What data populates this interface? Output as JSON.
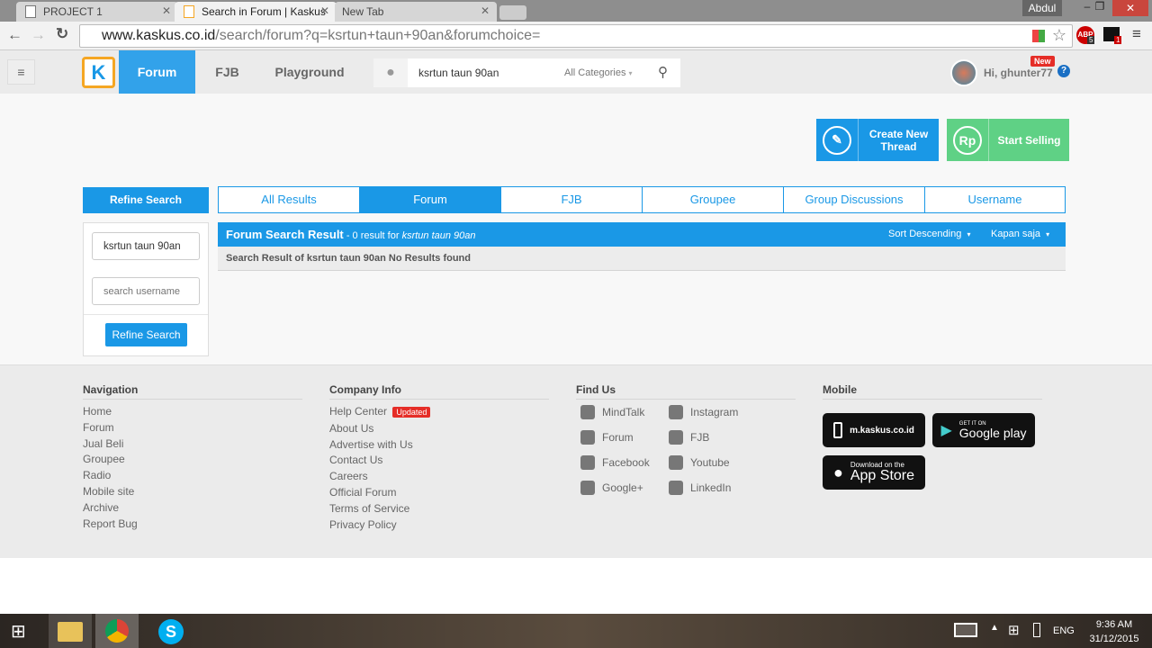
{
  "browser": {
    "tabs": [
      {
        "label": "PROJECT 1"
      },
      {
        "label": "Search in Forum | Kaskus -"
      },
      {
        "label": "New Tab"
      }
    ],
    "user": "Abdul",
    "url_host": "www.kaskus.co.id",
    "url_path": "/search/forum?q=ksrtun+taun+90an&forumchoice=",
    "abp_count": "5",
    "ext_count": "1"
  },
  "header": {
    "nav": [
      "Forum",
      "FJB",
      "Playground"
    ],
    "search_value": "ksrtun taun 90an",
    "category": "All Categories",
    "new_badge": "New",
    "greeting": "Hi, ghunter77"
  },
  "actions": {
    "create": "Create New Thread",
    "sell": "Start Selling"
  },
  "refine": {
    "title": "Refine Search",
    "query_value": "ksrtun taun 90an",
    "username_placeholder": "search username",
    "button": "Refine Search"
  },
  "search_tabs": [
    {
      "label": "All Results"
    },
    {
      "label": "Forum",
      "active": true
    },
    {
      "label": "FJB"
    },
    {
      "label": "Groupee"
    },
    {
      "label": "Group Discussions"
    },
    {
      "label": "Username"
    }
  ],
  "result": {
    "title": "Forum Search Result",
    "summary": " - 0 result for ",
    "query": "ksrtun taun 90an",
    "sort": "Sort Descending",
    "time": "Kapan saja",
    "message": "Search Result of ksrtun taun 90an No Results found"
  },
  "footer": {
    "navigation": {
      "title": "Navigation",
      "items": [
        "Home",
        "Forum",
        "Jual Beli",
        "Groupee",
        "Radio",
        "Mobile site",
        "Archive",
        "Report Bug"
      ]
    },
    "company": {
      "title": "Company Info",
      "items": [
        "Help Center",
        "About Us",
        "Advertise with Us",
        "Contact Us",
        "Careers",
        "Official Forum",
        "Terms of Service",
        "Privacy Policy"
      ],
      "updated": "Updated"
    },
    "findus": {
      "title": "Find Us",
      "left": [
        "MindTalk",
        "Forum",
        "Facebook",
        "Google+"
      ],
      "right": [
        "Instagram",
        "FJB",
        "Youtube",
        "LinkedIn"
      ]
    },
    "mobile": {
      "title": "Mobile",
      "site": "m.kaskus.co.id",
      "gp_top": "GET IT ON",
      "gp": "Google play",
      "as_top": "Download on the",
      "as": "App Store"
    }
  },
  "taskbar": {
    "lang": "ENG",
    "time": "9:36 AM",
    "date": "31/12/2015"
  },
  "colors": {
    "brand": "#1a98e6",
    "sell": "#5fd185",
    "new": "#e52d27"
  }
}
